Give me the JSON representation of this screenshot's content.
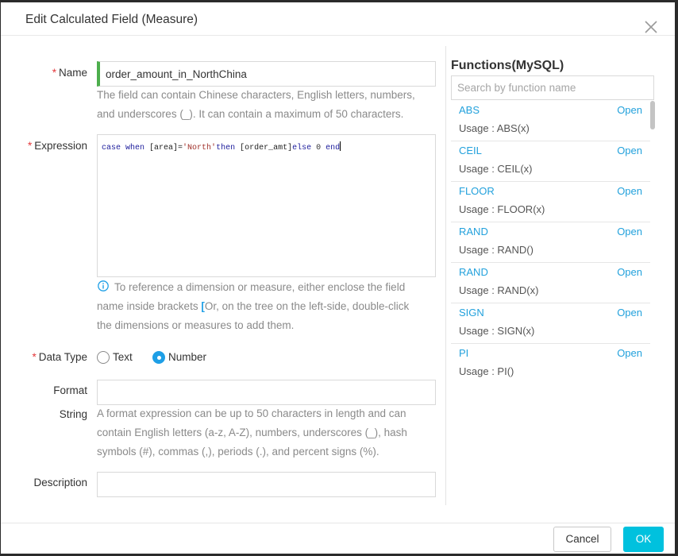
{
  "dialog": {
    "title": "Edit Calculated Field (Measure)"
  },
  "icons": {
    "close": "close-icon",
    "info": "info-icon"
  },
  "colors": {
    "accent": "#00c1de",
    "link": "#22a1dc",
    "required": "#e4393c",
    "name_indicator": "#4cae4c",
    "primary_blue": "#1e9fe6"
  },
  "form": {
    "name": {
      "required_mark": "*",
      "label": "Name",
      "value": "order_amount_in_NorthChina",
      "help_lines": [
        "The field can contain Chinese characters, English letters, numbers,",
        "and underscores (_). It can contain a maximum of 50 characters."
      ]
    },
    "expression": {
      "required_mark": "*",
      "label": "Expression",
      "tokens": [
        "case when ",
        "[area]",
        "=",
        "'North'",
        "then ",
        "[order_amt]",
        "else ",
        "0",
        " end"
      ],
      "hint": {
        "line1": "To reference a dimension or measure, either enclose the field",
        "line2_before": "name inside brackets ",
        "bracket": "[",
        "line2_after": "Or, on the tree on the left-side, double-click",
        "line3": "the dimensions or measures to add them."
      }
    },
    "data_type": {
      "required_mark": "*",
      "label": "Data Type",
      "options": [
        {
          "label": "Text",
          "checked": false
        },
        {
          "label": "Number",
          "checked": true
        }
      ]
    },
    "format_string": {
      "label_lines": [
        "Format",
        "String"
      ],
      "value": "",
      "help_lines": [
        "A format expression can be up to 50 characters in length and can",
        "contain English letters (a-z, A-Z), numbers, underscores (_), hash",
        "symbols (#), commas (,), periods (.), and percent signs (%)."
      ]
    },
    "description": {
      "label": "Description",
      "value": ""
    }
  },
  "functions": {
    "title": "Functions(MySQL)",
    "search_placeholder": "Search by function name",
    "search_value": "",
    "items": [
      {
        "name": "ABS",
        "action": "Open",
        "usage": "Usage : ABS(x)"
      },
      {
        "name": "CEIL",
        "action": "Open",
        "usage": "Usage : CEIL(x)"
      },
      {
        "name": "FLOOR",
        "action": "Open",
        "usage": "Usage : FLOOR(x)"
      },
      {
        "name": "RAND",
        "action": "Open",
        "usage": "Usage : RAND()"
      },
      {
        "name": "RAND",
        "action": "Open",
        "usage": "Usage : RAND(x)"
      },
      {
        "name": "SIGN",
        "action": "Open",
        "usage": "Usage : SIGN(x)"
      },
      {
        "name": "PI",
        "action": "Open",
        "usage": "Usage : PI()"
      }
    ]
  },
  "footer": {
    "cancel_label": "Cancel",
    "ok_label": "OK"
  }
}
